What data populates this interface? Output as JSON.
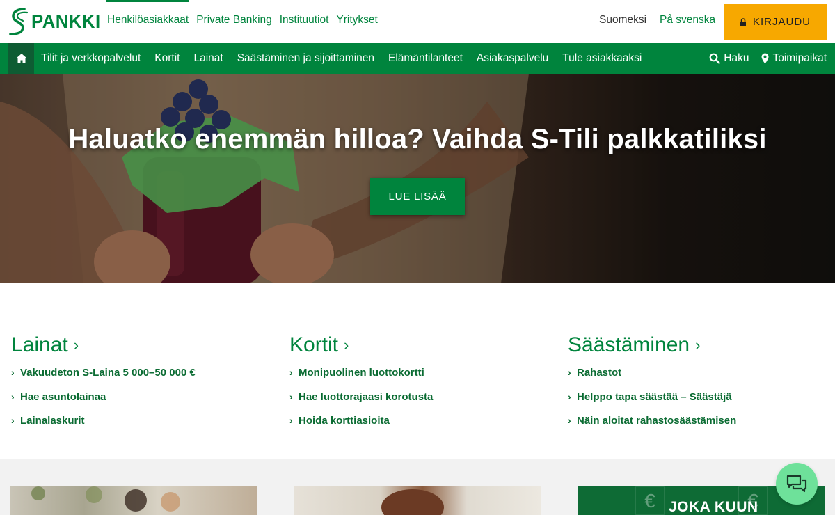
{
  "header": {
    "logo_text": "PANKKI",
    "segments": [
      {
        "label": "Henkilöasiakkaat",
        "active": true
      },
      {
        "label": "Private Banking",
        "active": false
      },
      {
        "label": "Instituutiot",
        "active": false
      },
      {
        "label": "Yritykset",
        "active": false
      }
    ],
    "languages": {
      "fi": "Suomeksi",
      "sv": "På svenska"
    },
    "login_label": "KIRJAUDU",
    "login_icon": "lock-icon"
  },
  "nav": {
    "home_icon": "home-icon",
    "items": [
      "Tilit ja verkkopalvelut",
      "Kortit",
      "Lainat",
      "Säästäminen ja sijoittaminen",
      "Elämäntilanteet",
      "Asiakaspalvelu",
      "Tule asiakkaaksi"
    ],
    "search_label": "Haku",
    "locations_label": "Toimipaikat"
  },
  "hero": {
    "title": "Haluatko enemmän hilloa? Vaihda S-Tili palkkatiliksi",
    "cta_label": "LUE LISÄÄ"
  },
  "columns": [
    {
      "title": "Lainat",
      "links": [
        "Vakuudeton S-Laina 5 000–50 000 €",
        "Hae asuntolainaa",
        "Lainalaskurit"
      ]
    },
    {
      "title": "Kortit",
      "links": [
        "Monipuolinen luottokortti",
        "Hae luottorajaasi korotusta",
        "Hoida korttiasioita"
      ]
    },
    {
      "title": "Säästäminen",
      "links": [
        "Rahastot",
        "Helppo tapa säästää – Säästäjä",
        "Näin aloitat rahastosäästämisen"
      ]
    }
  ],
  "cards": {
    "card3_caption": "JOKA KUUN",
    "euro_symbol": "€"
  },
  "colors": {
    "brand_green": "#00843d",
    "nav_dark_green": "#0e5c33",
    "login_orange": "#f7a800",
    "chat_green": "#6ee19a"
  }
}
